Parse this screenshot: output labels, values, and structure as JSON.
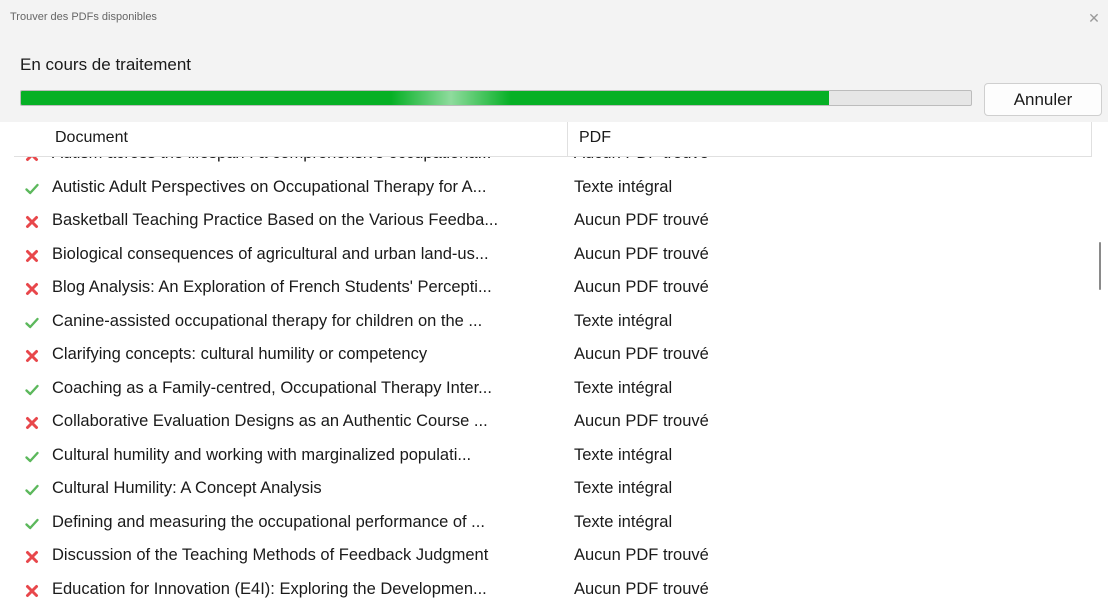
{
  "window": {
    "title": "Trouver des PDFs disponibles",
    "close_glyph": "✕"
  },
  "status": {
    "label": "En cours de traitement",
    "progress": 0.85,
    "progress_color": "#06b025"
  },
  "cancel_label": "Annuler",
  "columns": {
    "document": "Document",
    "pdf": "PDF"
  },
  "icons": {
    "success": "check-icon",
    "failure": "cross-icon",
    "success_color": "#5cb85c",
    "failure_color": "#e8474b"
  },
  "rows": [
    {
      "status": "failure",
      "document": "Autism across the lifespan : a comprehensive occupationa...",
      "pdf": "Aucun PDF trouvé"
    },
    {
      "status": "success",
      "document": "Autistic Adult Perspectives on Occupational Therapy for A...",
      "pdf": "Texte intégral"
    },
    {
      "status": "failure",
      "document": "Basketball Teaching Practice Based on the Various Feedba...",
      "pdf": "Aucun PDF trouvé"
    },
    {
      "status": "failure",
      "document": "Biological consequences of agricultural and urban land-us...",
      "pdf": "Aucun PDF trouvé"
    },
    {
      "status": "failure",
      "document": "Blog Analysis: An Exploration of French Students' Percepti...",
      "pdf": "Aucun PDF trouvé"
    },
    {
      "status": "success",
      "document": "Canine-assisted occupational therapy for children on the ...",
      "pdf": "Texte intégral"
    },
    {
      "status": "failure",
      "document": "Clarifying concepts: cultural humility or competency",
      "pdf": "Aucun PDF trouvé"
    },
    {
      "status": "success",
      "document": "Coaching as a Family-centred, Occupational Therapy Inter...",
      "pdf": "Texte intégral"
    },
    {
      "status": "failure",
      "document": "Collaborative Evaluation Designs as an Authentic Course ...",
      "pdf": "Aucun PDF trouvé"
    },
    {
      "status": "success",
      "document": "Cultural humility and working with marginalized populati...",
      "pdf": "Texte intégral"
    },
    {
      "status": "success",
      "document": "Cultural Humility: A Concept Analysis",
      "pdf": "Texte intégral"
    },
    {
      "status": "success",
      "document": "Defining and measuring the occupational performance of ...",
      "pdf": "Texte intégral"
    },
    {
      "status": "failure",
      "document": "Discussion of the Teaching Methods of Feedback Judgment",
      "pdf": "Aucun PDF trouvé"
    },
    {
      "status": "failure",
      "document": "Education for Innovation (E4I): Exploring the Developmen...",
      "pdf": "Aucun PDF trouvé"
    }
  ]
}
